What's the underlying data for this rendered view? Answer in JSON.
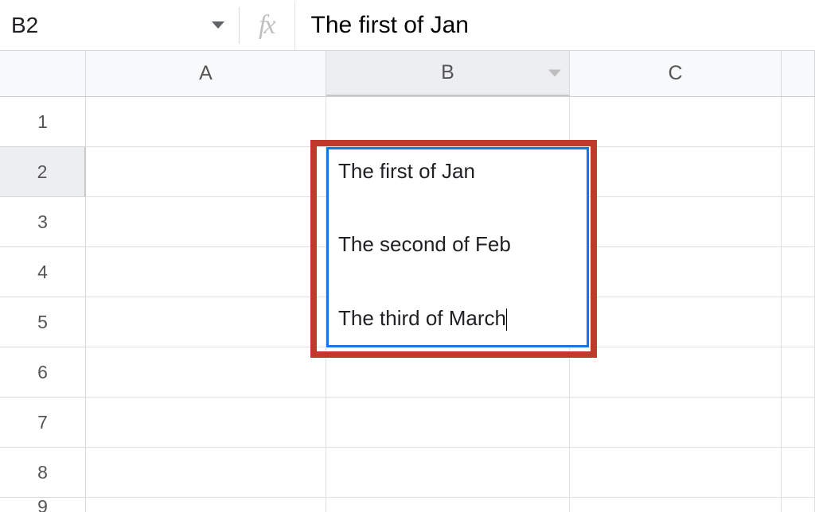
{
  "colors": {
    "selection": "#1a73e8",
    "annotation": "#c0392b"
  },
  "formula_bar": {
    "cell_ref": "B2",
    "fx_label": "fx",
    "formula_value": "The first of Jan"
  },
  "columns": [
    "A",
    "B",
    "C"
  ],
  "rows": [
    "1",
    "2",
    "3",
    "4",
    "5",
    "6",
    "7",
    "8",
    "9"
  ],
  "active_cell": "B2",
  "active_column": "B",
  "active_row": "2",
  "editor_lines": [
    "The first of Jan",
    "The second of Feb",
    "The third of March"
  ],
  "cell_data": {
    "B2": "The first of Jan\nThe second of Feb\nThe third of March"
  }
}
